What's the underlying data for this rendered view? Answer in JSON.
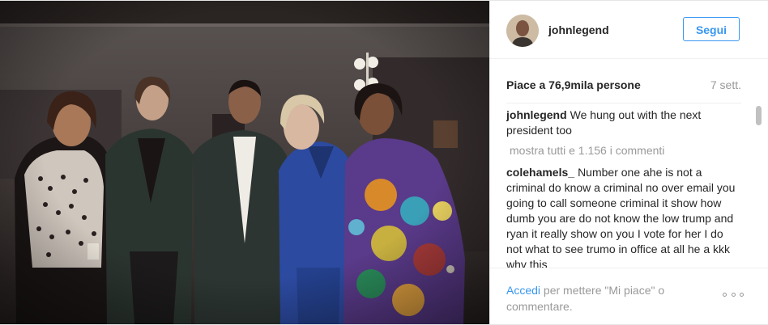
{
  "post": {
    "photo_alt": "",
    "header": {
      "username": "johnlegend",
      "follow_label": "Segui"
    },
    "likes": "Piace a 76,9mila persone",
    "time": "7 sett.",
    "caption": {
      "username": "johnlegend",
      "text": "We hung out with the next president too"
    },
    "show_all_comments": "mostra tutti e 1.156 i commenti",
    "comments": [
      {
        "username": "colehamels_",
        "text": "Number one ahe is not a criminal do know a criminal no over email you going to call someone criminal it show how dumb you are do not know the low trump and ryan it really show on you I vote for her I do not what to see trumo in office at all he a kkk why this"
      }
    ],
    "footer": {
      "login_label": "Accedi",
      "login_suffix": "per mettere \"Mi piace\" o commentare."
    },
    "colors": {
      "accent": "#3897f0",
      "muted": "#999999",
      "text": "#262626"
    }
  }
}
